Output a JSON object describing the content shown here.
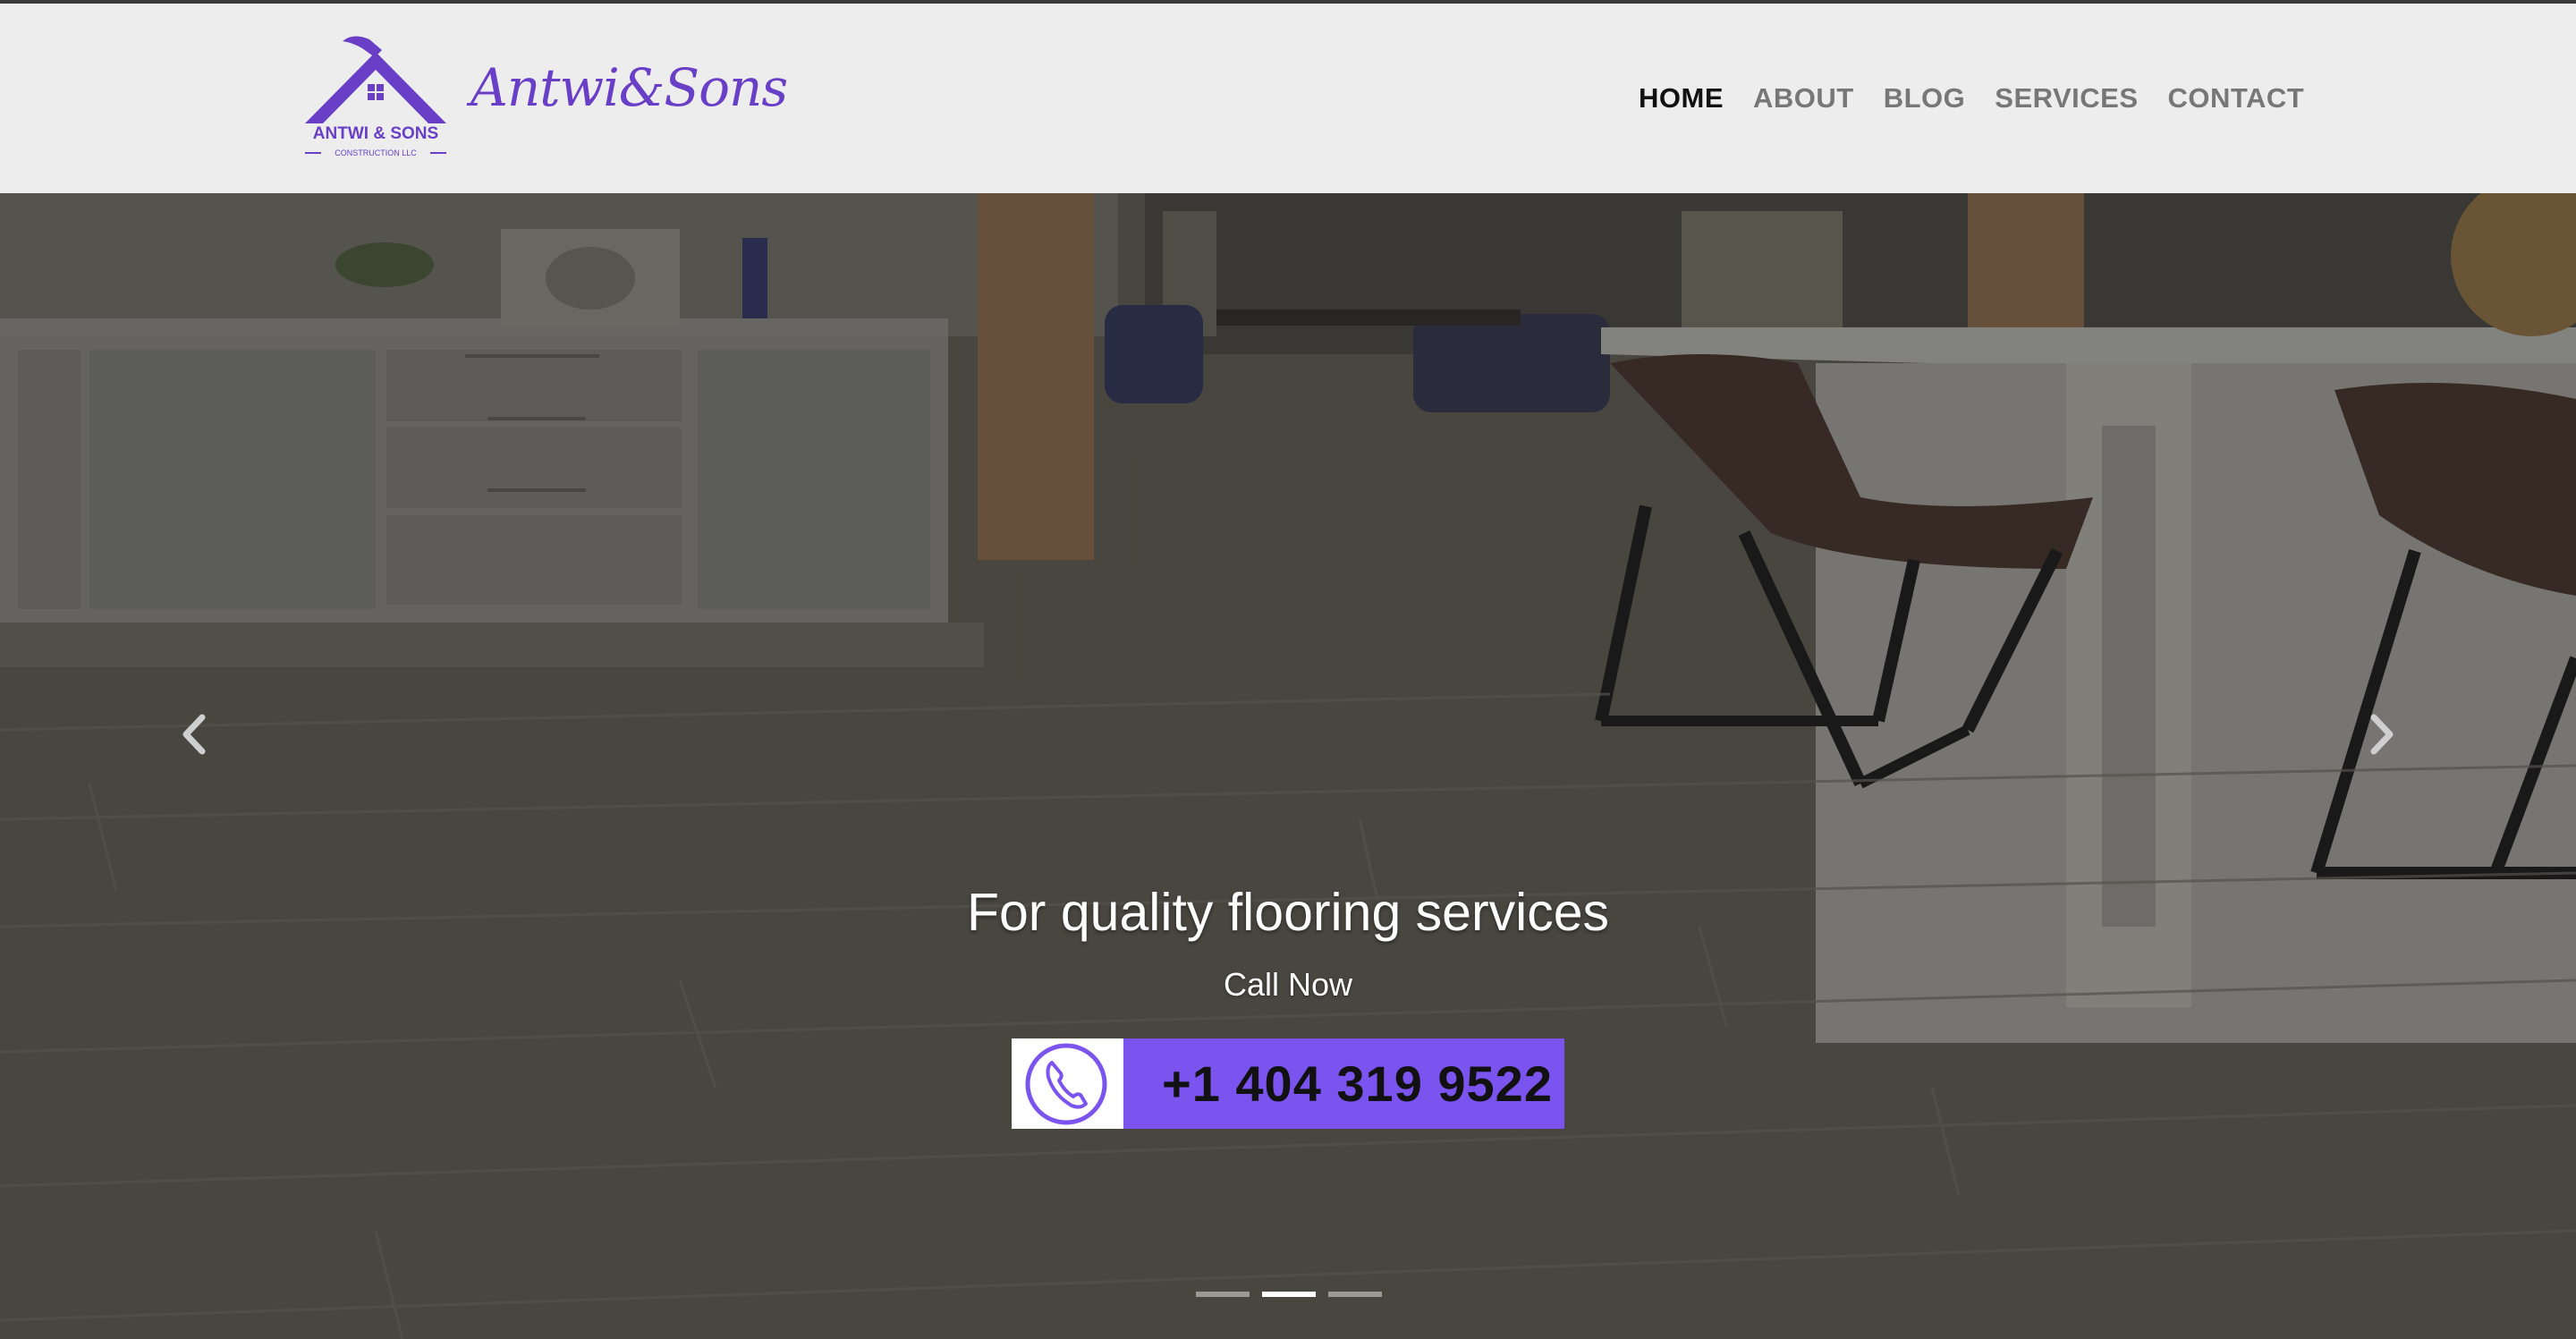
{
  "brand": {
    "logo_text_main": "ANTWI & SONS",
    "logo_text_sub": "CONSTRUCTION LLC",
    "name": "Antwi&Sons",
    "color": "#6a3fc8"
  },
  "nav": {
    "items": [
      {
        "label": "HOME",
        "active": true
      },
      {
        "label": "ABOUT",
        "active": false
      },
      {
        "label": "BLOG",
        "active": false
      },
      {
        "label": "SERVICES",
        "active": false
      },
      {
        "label": "CONTACT",
        "active": false
      }
    ]
  },
  "hero": {
    "heading": "For quality flooring services",
    "subheading": "Call Now",
    "phone": "+1 404 319 9522",
    "phone_button_color": "#7b54ef",
    "prev_icon": "chevron-left-icon",
    "next_icon": "chevron-right-icon",
    "slides_total": 3,
    "active_slide": 2
  }
}
